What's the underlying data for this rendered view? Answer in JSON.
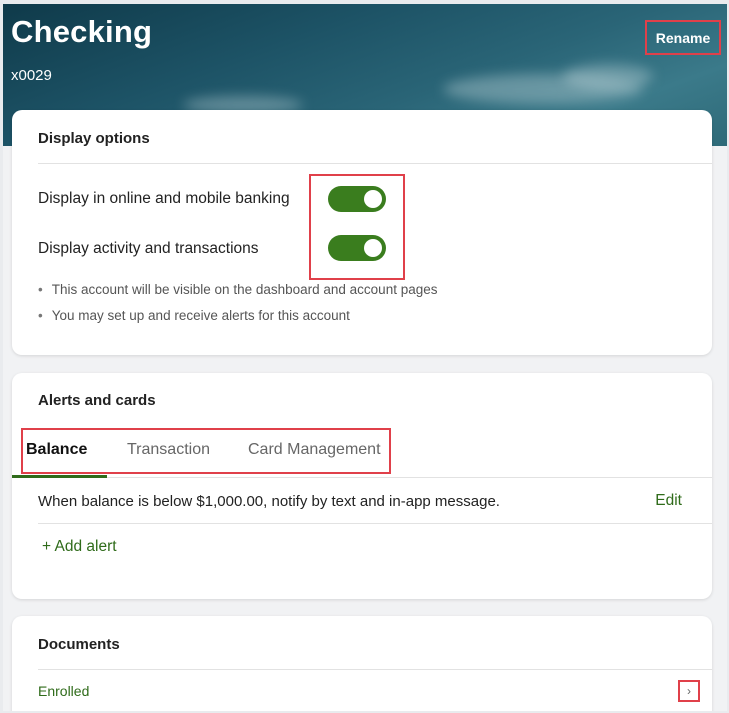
{
  "header": {
    "title": "Checking",
    "account_number": "x0029",
    "rename_label": "Rename"
  },
  "display_options": {
    "title": "Display options",
    "toggles": [
      {
        "label": "Display in online and mobile banking",
        "on": true
      },
      {
        "label": "Display activity and transactions",
        "on": true
      }
    ],
    "bullets": [
      "This account will be visible on the dashboard and account pages",
      "You may set up and receive alerts for this account"
    ]
  },
  "alerts_cards": {
    "title": "Alerts and cards",
    "tabs": [
      "Balance",
      "Transaction",
      "Card Management"
    ],
    "active_tab": "Balance",
    "alert_text": "When balance is below $1,000.00, notify by text and in-app message.",
    "edit_label": "Edit",
    "add_alert_label": "+ Add alert"
  },
  "documents": {
    "title": "Documents",
    "status": "Enrolled",
    "chevron": "›"
  },
  "colors": {
    "accent_green": "#3a7d1e",
    "highlight_red": "#e0404a"
  }
}
